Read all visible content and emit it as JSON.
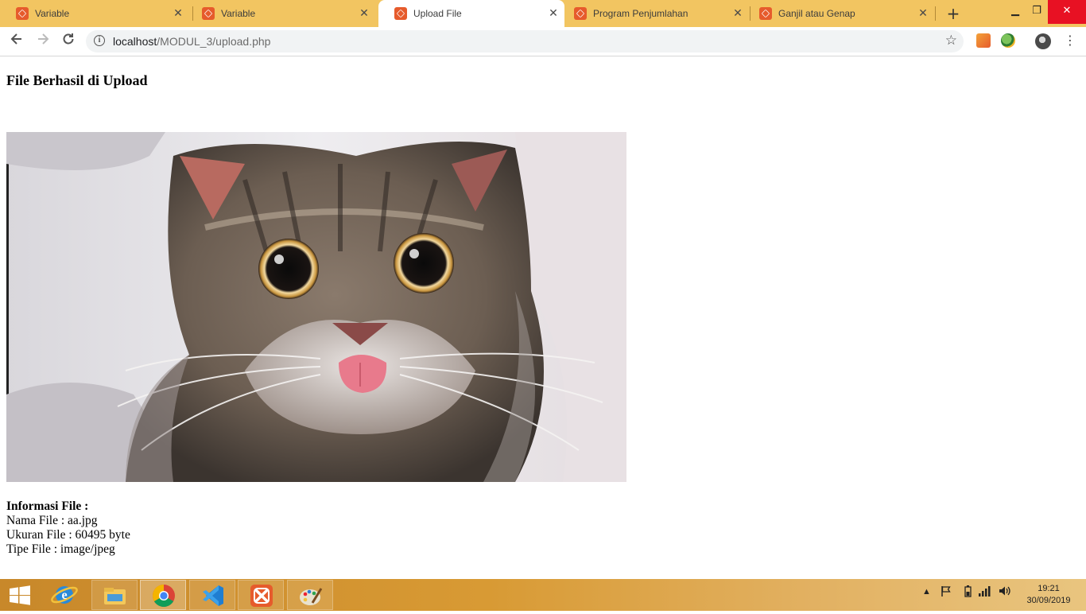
{
  "browser": {
    "tabs": [
      {
        "title": "Variable",
        "active": false
      },
      {
        "title": "Variable",
        "active": false
      },
      {
        "title": "Upload File",
        "active": true
      },
      {
        "title": "Program Penjumlahan",
        "active": false
      },
      {
        "title": "Ganjil atau Genap",
        "active": false
      }
    ],
    "new_tab_label": "+",
    "url_host": "localhost",
    "url_path": "/MODUL_3/upload.php"
  },
  "page": {
    "heading": "File Berhasil di Upload",
    "info_title": "Informasi File :",
    "file_name_line": "Nama File : aa.jpg",
    "file_size_line": "Ukuran File : 60495 byte",
    "file_type_line": "Tipe File : image/jpeg"
  },
  "taskbar": {
    "apps": [
      "windows-start",
      "internet-explorer",
      "file-explorer",
      "chrome",
      "vscode",
      "xampp",
      "paint"
    ],
    "clock_time": "19:21",
    "clock_date": "30/09/2019"
  },
  "colors": {
    "tabstrip": "#f2c561",
    "taskbar": "#d89a34",
    "close_button": "#e81123",
    "xampp_orange": "#e65b2c"
  }
}
